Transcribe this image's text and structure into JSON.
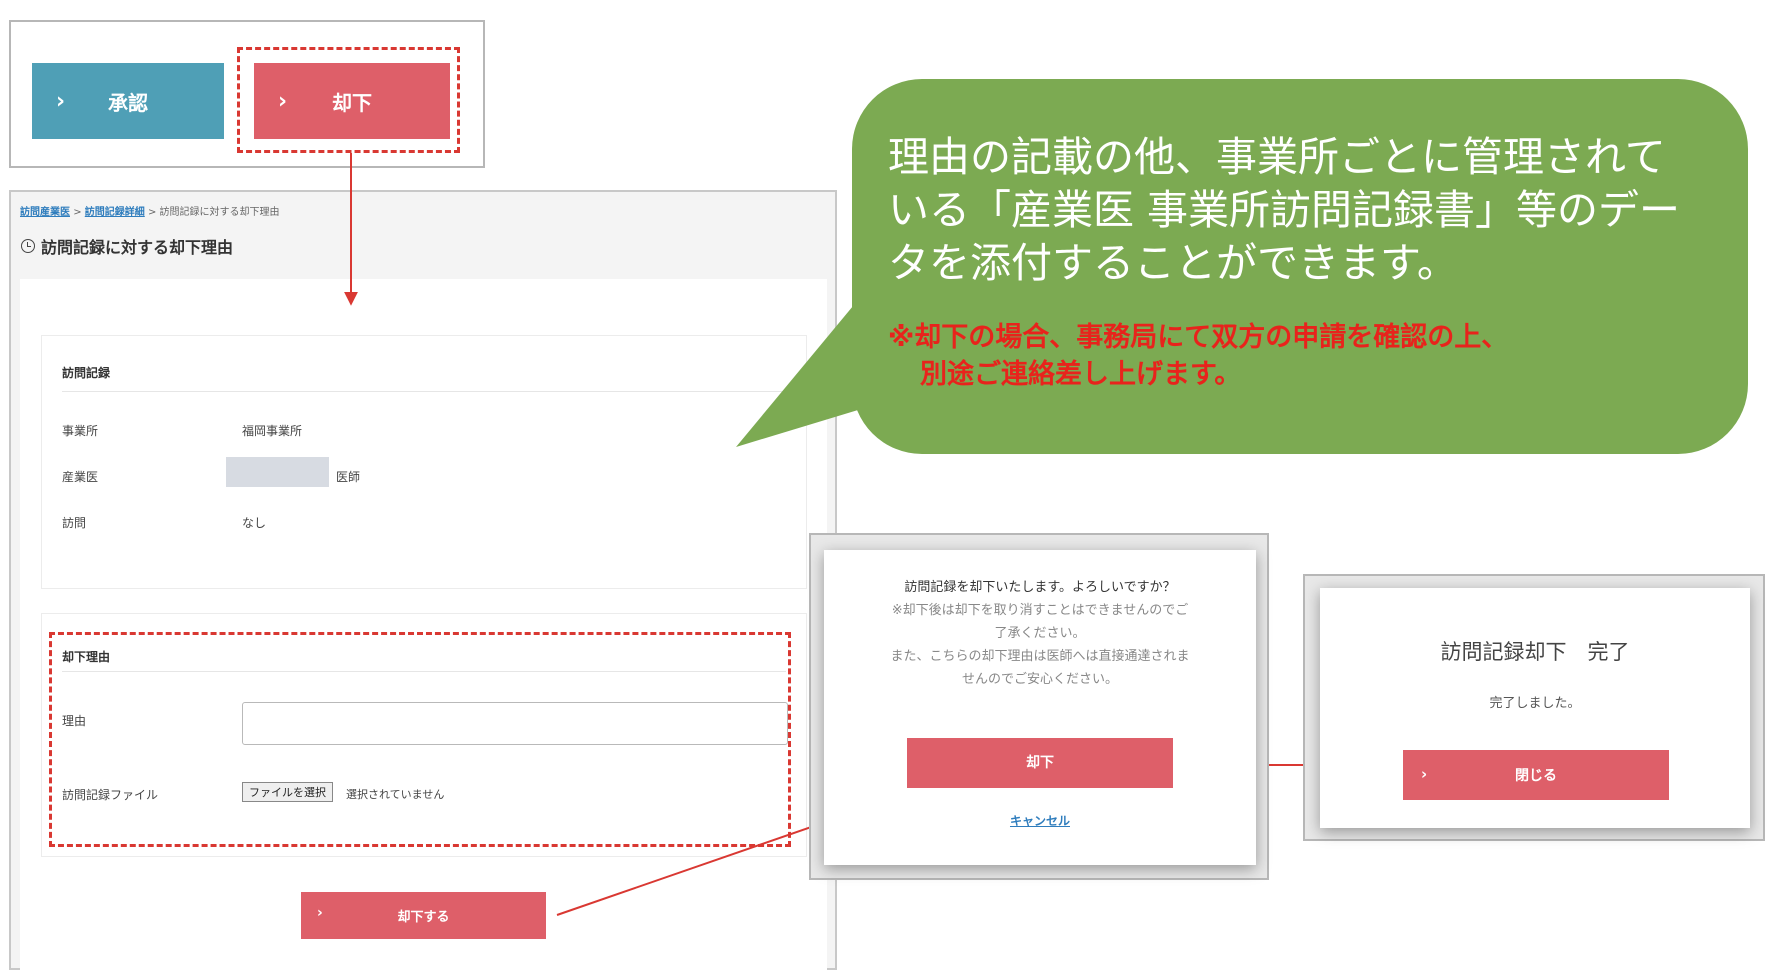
{
  "top_buttons": {
    "approve_label": "承認",
    "reject_label": "却下"
  },
  "breadcrumb": {
    "item1": "訪問産業医",
    "item2": "訪問記録詳細",
    "item3": "訪問記録に対する却下理由",
    "sep": ">"
  },
  "page_title": "訪問記録に対する却下理由",
  "record_card": {
    "heading": "訪問記録",
    "office_label": "事業所",
    "office_value": "福岡事業所",
    "doctor_label": "産業医",
    "doctor_suffix": "医師",
    "visit_label": "訪問",
    "visit_value": "なし"
  },
  "reason_card": {
    "heading": "却下理由",
    "reason_label": "理由",
    "file_label": "訪問記録ファイル",
    "file_button": "ファイルを選択",
    "file_status": "選択されていません"
  },
  "submit_button": "却下する",
  "callout": {
    "line1": "理由の記載の他、事業所ごとに管理されて",
    "line2": "いる「産業医 事業所訪問記録書」等のデー",
    "line3": "タを添付することができます。",
    "note1": "※却下の場合、事務局にて双方の申請を確認の上、",
    "note2": "別途ご連絡差し上げます。"
  },
  "confirm_dialog": {
    "question": "訪問記録を却下いたします。よろしいですか？",
    "note1": "※却下後は却下を取り消すことはできませんのでご",
    "note2": "了承ください。",
    "note3": "また、こちらの却下理由は医師へは直接通達されま",
    "note4": "せんのでご安心ください。",
    "confirm_button": "却下",
    "cancel_link": "キャンセル"
  },
  "complete_dialog": {
    "title": "訪問記録却下　完了",
    "message": "完了しました。",
    "close_button": "閉じる"
  },
  "colors": {
    "approve": "#4f9fb6",
    "reject": "#de5f69",
    "callout": "#7caa52",
    "note_red": "#e8231c",
    "link": "#2f7dbd",
    "dashed": "#d93832"
  }
}
